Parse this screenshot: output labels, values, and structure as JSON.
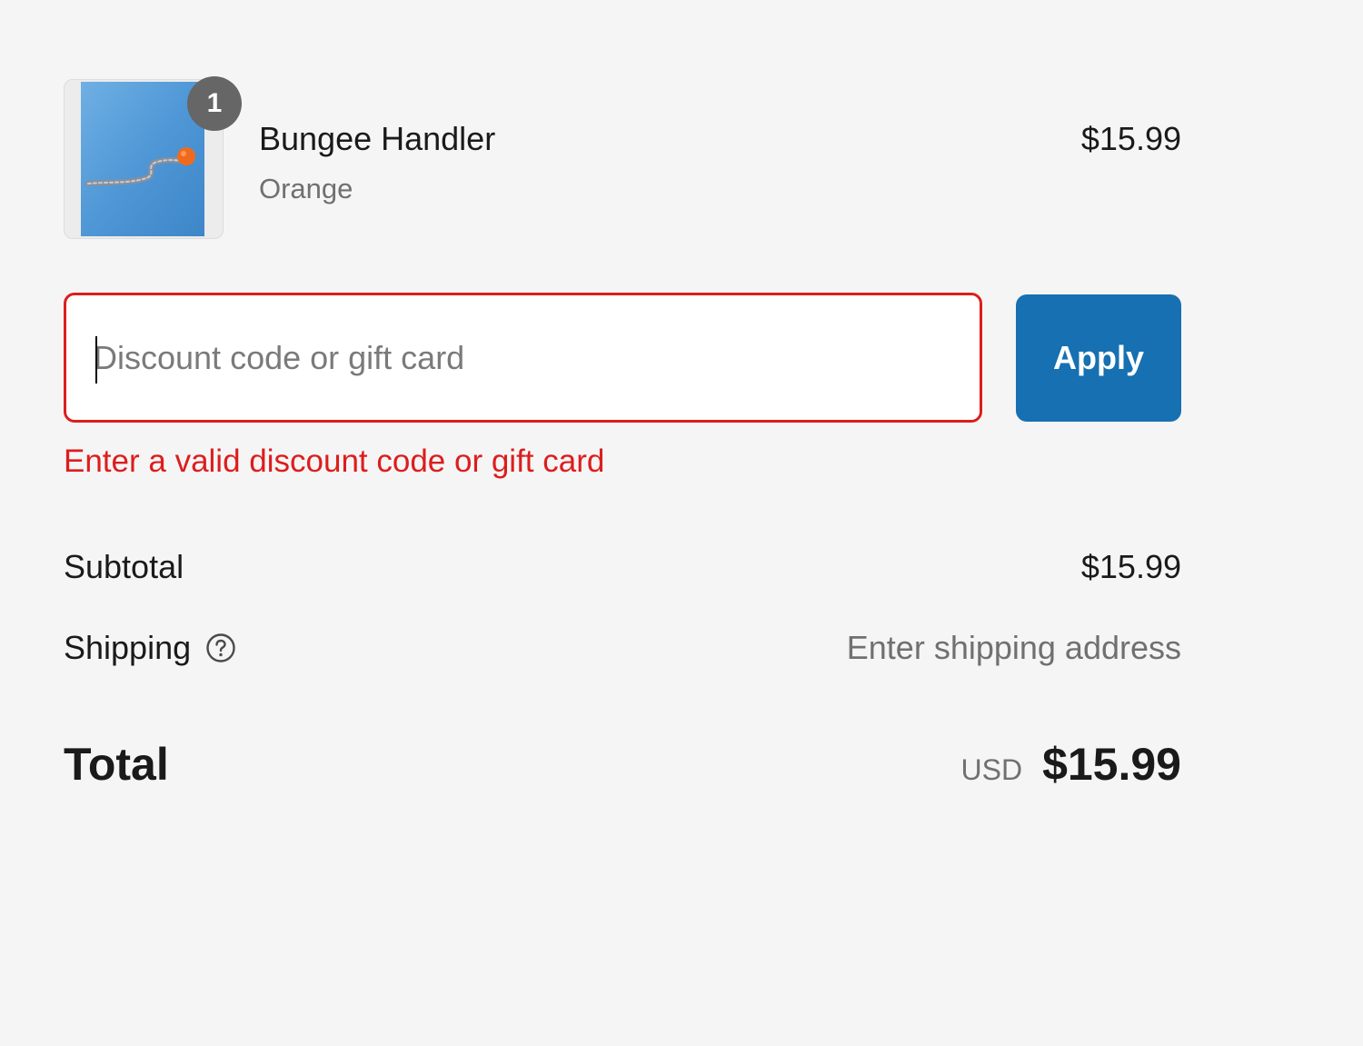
{
  "line_item": {
    "quantity": "1",
    "name": "Bungee Handler",
    "variant": "Orange",
    "price": "$15.99",
    "image_icon": "product-thumbnail"
  },
  "discount": {
    "placeholder": "Discount code or gift card",
    "value": "",
    "apply_label": "Apply",
    "error": "Enter a valid discount code or gift card",
    "error_color": "#dd1d1d",
    "button_color": "#1670b1"
  },
  "totals": {
    "subtotal_label": "Subtotal",
    "subtotal_value": "$15.99",
    "shipping_label": "Shipping",
    "shipping_value": "Enter shipping address",
    "shipping_help_icon": "question-circle-icon",
    "total_label": "Total",
    "total_currency": "USD",
    "total_value": "$15.99"
  }
}
